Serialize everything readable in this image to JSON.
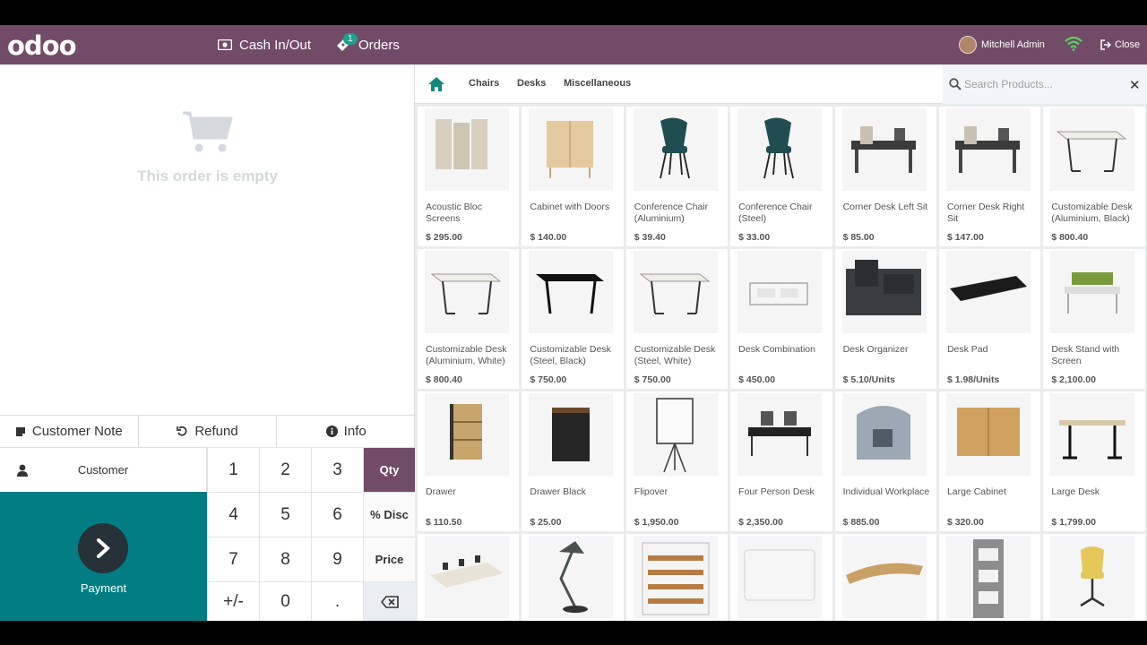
{
  "header": {
    "logo": "odoo",
    "cash_label": "Cash In/Out",
    "orders_label": "Orders",
    "orders_badge": "1",
    "user_name": "Mitchell Admin",
    "close_label": "Close"
  },
  "order": {
    "empty_text": "This order is empty"
  },
  "controls": {
    "customer_note": "Customer Note",
    "refund": "Refund",
    "info": "Info",
    "customer": "Customer",
    "payment": "Payment"
  },
  "numpad": {
    "keys": [
      "1",
      "2",
      "3",
      "Qty",
      "4",
      "5",
      "6",
      "% Disc",
      "7",
      "8",
      "9",
      "Price",
      "+/-",
      "0",
      "."
    ],
    "active_mode": "Qty"
  },
  "categories": {
    "items": [
      "Chairs",
      "Desks",
      "Miscellaneous"
    ],
    "search_placeholder": "Search Products..."
  },
  "products": [
    {
      "name": "Acoustic Bloc Screens",
      "price": "$ 295.00",
      "icon": "screen"
    },
    {
      "name": "Cabinet with Doors",
      "price": "$ 140.00",
      "icon": "cabinet"
    },
    {
      "name": "Conference Chair (Aluminium)",
      "price": "$ 39.40",
      "icon": "chair"
    },
    {
      "name": "Conference Chair (Steel)",
      "price": "$ 33.00",
      "icon": "chair"
    },
    {
      "name": "Corner Desk Left Sit",
      "price": "$ 85.00",
      "icon": "corner-desk"
    },
    {
      "name": "Corner Desk Right Sit",
      "price": "$ 147.00",
      "icon": "corner-desk"
    },
    {
      "name": "Customizable Desk (Aluminium, Black)",
      "price": "$ 800.40",
      "icon": "desk"
    },
    {
      "name": "Customizable Desk (Aluminium, White)",
      "price": "$ 800.40",
      "icon": "desk"
    },
    {
      "name": "Customizable Desk (Steel, Black)",
      "price": "$ 750.00",
      "icon": "desk-black"
    },
    {
      "name": "Customizable Desk (Steel, White)",
      "price": "$ 750.00",
      "icon": "desk"
    },
    {
      "name": "Desk Combination",
      "price": "$ 450.00",
      "icon": "desk-combo"
    },
    {
      "name": "Desk Organizer",
      "price": "$ 5.10/Units",
      "icon": "organizer"
    },
    {
      "name": "Desk Pad",
      "price": "$ 1.98/Units",
      "icon": "pad"
    },
    {
      "name": "Desk Stand with Screen",
      "price": "$ 2,100.00",
      "icon": "stand"
    },
    {
      "name": "Drawer",
      "price": "$ 110.50",
      "icon": "drawer"
    },
    {
      "name": "Drawer Black",
      "price": "$ 25.00",
      "icon": "drawer-black"
    },
    {
      "name": "Flipover",
      "price": "$ 1,950.00",
      "icon": "flipover"
    },
    {
      "name": "Four Person Desk",
      "price": "$ 2,350.00",
      "icon": "four-desk"
    },
    {
      "name": "Individual Workplace",
      "price": "$ 885.00",
      "icon": "workplace"
    },
    {
      "name": "Large Cabinet",
      "price": "$ 320.00",
      "icon": "large-cabinet"
    },
    {
      "name": "Large Desk",
      "price": "$ 1,799.00",
      "icon": "large-desk"
    },
    {
      "name": "",
      "price": "",
      "icon": "meeting-table"
    },
    {
      "name": "",
      "price": "",
      "icon": "lamp"
    },
    {
      "name": "",
      "price": "",
      "icon": "shelf"
    },
    {
      "name": "",
      "price": "",
      "icon": "whiteboard"
    },
    {
      "name": "",
      "price": "",
      "icon": "monitor-stand"
    },
    {
      "name": "",
      "price": "",
      "icon": "magazine-rack"
    },
    {
      "name": "",
      "price": "",
      "icon": "office-chair"
    }
  ]
}
